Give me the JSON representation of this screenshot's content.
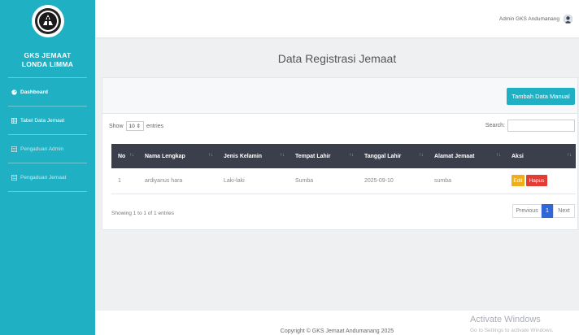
{
  "sidebar": {
    "brand_line1": "GKS JEMAAT",
    "brand_line2": "LONDA LIMMA",
    "items": [
      {
        "label": "Dashboard",
        "icon": "dashboard-icon"
      },
      {
        "label": "Tabel Data Jemaat",
        "icon": "table-icon"
      },
      {
        "label": "Pengaduan Admin",
        "icon": "list-icon"
      },
      {
        "label": "Pengaduan Jemaat",
        "icon": "list-icon"
      }
    ]
  },
  "topbar": {
    "user_name": "Admin GKS Andumanang"
  },
  "page": {
    "title": "Data Registrasi Jemaat"
  },
  "card": {
    "add_button": "Tambah Data Manual",
    "show_label": "Show",
    "show_value": "10",
    "entries_label": "entries",
    "search_label": "Search:",
    "search_value": ""
  },
  "table": {
    "columns": [
      "No",
      "Nama Lengkap",
      "Jenis Kelamin",
      "Tempat Lahir",
      "Tanggal Lahir",
      "Alamat Jemaat",
      "Aksi"
    ],
    "rows": [
      {
        "no": "1",
        "nama": "ardiyanus hara",
        "jk": "Laki-laki",
        "tempat": "Sumba",
        "tanggal": "2025-09-10",
        "alamat": "sumba",
        "edit": "Edit",
        "hapus": "Hapus"
      }
    ],
    "info": "Showing 1 to 1 of 1 entries",
    "pager": {
      "prev": "Previous",
      "current": "1",
      "next": "Next"
    }
  },
  "footer": {
    "copyright": "Copyright © GKS Jemaat Andumanang 2025"
  },
  "watermark": {
    "line1": "Activate Windows",
    "line2": "Go to Settings to activate Windows."
  },
  "colors": {
    "sidebar": "#1fb0c4",
    "table_header": "#3a3f4b",
    "edit": "#f0ad1a",
    "delete": "#e23c34",
    "page_active": "#2f67d9"
  }
}
